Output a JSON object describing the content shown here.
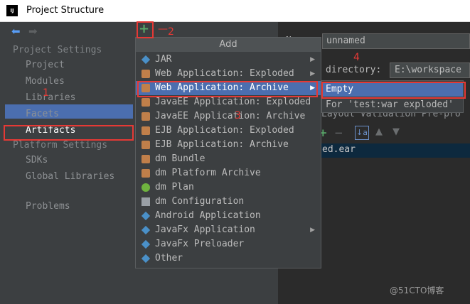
{
  "window": {
    "title": "Project Structure",
    "logo_text": "IJ"
  },
  "nav": {
    "back_icon": "back-arrow-icon",
    "forward_icon": "forward-arrow-icon"
  },
  "sidebar": {
    "project_settings_header": "Project Settings",
    "project_items": [
      "Project",
      "Modules",
      "Libraries",
      "Facets",
      "Artifacts"
    ],
    "selected_item": "Artifacts",
    "platform_settings_header": "Platform Settings",
    "platform_items": [
      "SDKs",
      "Global Libraries"
    ],
    "problems": "Problems"
  },
  "toolbar": {
    "add_symbol": "+"
  },
  "add_menu": {
    "header": "Add",
    "items": [
      {
        "label": "JAR",
        "icon": "diamond-icon",
        "submenu": true
      },
      {
        "label": "Web Application: Exploded",
        "icon": "jar-icon",
        "submenu": true
      },
      {
        "label": "Web Application: Archive",
        "icon": "jar-icon",
        "submenu": true,
        "selected": true
      },
      {
        "label": "JavaEE Application: Exploded",
        "icon": "jar-icon",
        "submenu": false
      },
      {
        "label": "JavaEE Application: Archive",
        "icon": "jar-icon",
        "submenu": false
      },
      {
        "label": "EJB Application: Exploded",
        "icon": "jar-icon",
        "submenu": false
      },
      {
        "label": "EJB Application: Archive",
        "icon": "jar-icon",
        "submenu": false
      },
      {
        "label": "dm Bundle",
        "icon": "bundle-icon",
        "submenu": false
      },
      {
        "label": "dm Platform Archive",
        "icon": "bundle-icon",
        "submenu": false
      },
      {
        "label": "dm Plan",
        "icon": "plan-icon",
        "submenu": false
      },
      {
        "label": "dm Configuration",
        "icon": "document-icon",
        "submenu": false
      },
      {
        "label": "Android Application",
        "icon": "diamond-icon",
        "submenu": false
      },
      {
        "label": "JavaFx Application",
        "icon": "diamond-icon",
        "submenu": true
      },
      {
        "label": "JavaFx Preloader",
        "icon": "diamond-icon",
        "submenu": false
      },
      {
        "label": "Other",
        "icon": "diamond-icon",
        "submenu": false
      }
    ]
  },
  "submenu": {
    "items": [
      {
        "label": "Empty",
        "selected": true
      },
      {
        "label": "For 'test:war exploded'",
        "selected": false
      }
    ]
  },
  "right_panel": {
    "name_value": "unnamed",
    "name_label_partial": "N",
    "directory_label": "directory:",
    "directory_value": "E:\\workspace",
    "tabs_partial": "Layout  Validation  Pre-pro",
    "tree_item": "ed.ear"
  },
  "annotations": {
    "num1": "1",
    "num2": "2",
    "num3": "3",
    "num4": "4"
  },
  "watermark": "@51CTO博客",
  "colors": {
    "selection": "#4b6eaf",
    "annotation_red": "#e53935",
    "add_green": "#59a869",
    "background": "#3c3f41"
  }
}
